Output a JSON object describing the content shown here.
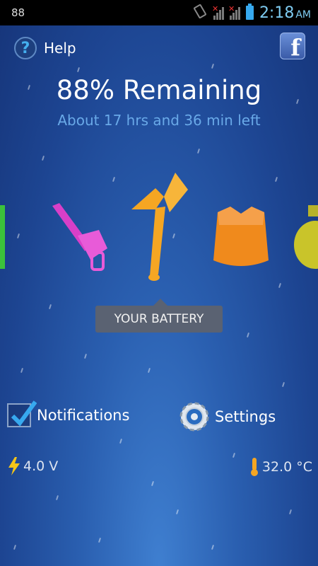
{
  "status_bar": {
    "left_text": "88",
    "time": "2:18",
    "ampm": "AM"
  },
  "help": {
    "icon": "?",
    "label": "Help"
  },
  "facebook": {
    "letter": "f"
  },
  "battery": {
    "percent_text": "88% Remaining",
    "time_left": "About 17 hrs and 36 min left"
  },
  "carousel": {
    "items": [
      "green-item-icon",
      "chainsaw-icon",
      "axe-icon",
      "armor-vest-icon",
      "grenade-icon"
    ],
    "tooltip": "YOUR BATTERY"
  },
  "notifications": {
    "label": "Notifications",
    "checked": true
  },
  "settings": {
    "label": "Settings"
  },
  "voltage": {
    "value": "4.0 V"
  },
  "temperature": {
    "value": "32.0 °C"
  }
}
